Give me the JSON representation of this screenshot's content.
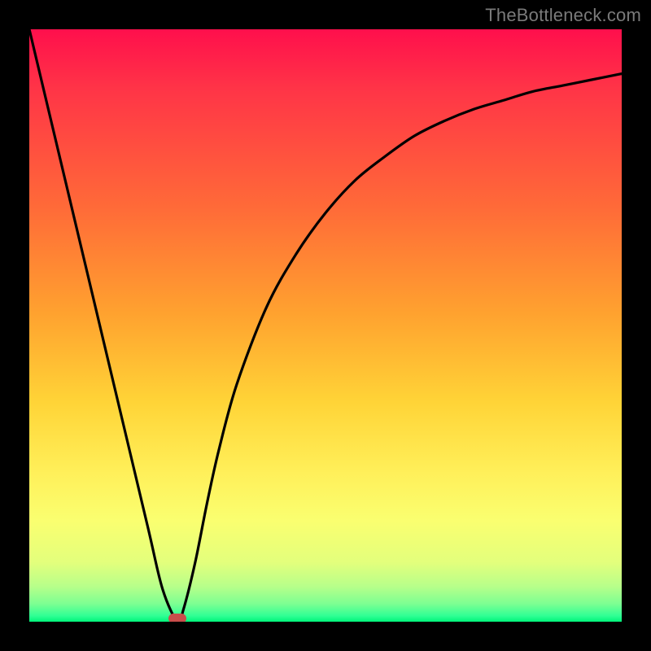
{
  "watermark": "TheBottleneck.com",
  "colors": {
    "background": "#000000",
    "curve": "#000000",
    "marker": "#c94d4b",
    "gradient_top": "#ff0f4c",
    "gradient_bottom": "#00f57a"
  },
  "chart_data": {
    "type": "line",
    "title": "",
    "xlabel": "",
    "ylabel": "",
    "xlim": [
      0,
      100
    ],
    "ylim": [
      0,
      100
    ],
    "grid": false,
    "legend": false,
    "annotations": [],
    "x": [
      0,
      5,
      10,
      15,
      20,
      22.5,
      25,
      26,
      28,
      30,
      32,
      35,
      40,
      45,
      50,
      55,
      60,
      65,
      70,
      75,
      80,
      85,
      90,
      95,
      100
    ],
    "y": [
      100,
      79,
      58,
      37,
      16,
      5.5,
      0,
      2,
      10,
      20,
      29,
      40,
      53,
      62,
      69,
      74.5,
      78.5,
      82,
      84.5,
      86.5,
      88,
      89.5,
      90.5,
      91.5,
      92.5
    ],
    "min_point": {
      "x": 25,
      "y": 0
    }
  }
}
